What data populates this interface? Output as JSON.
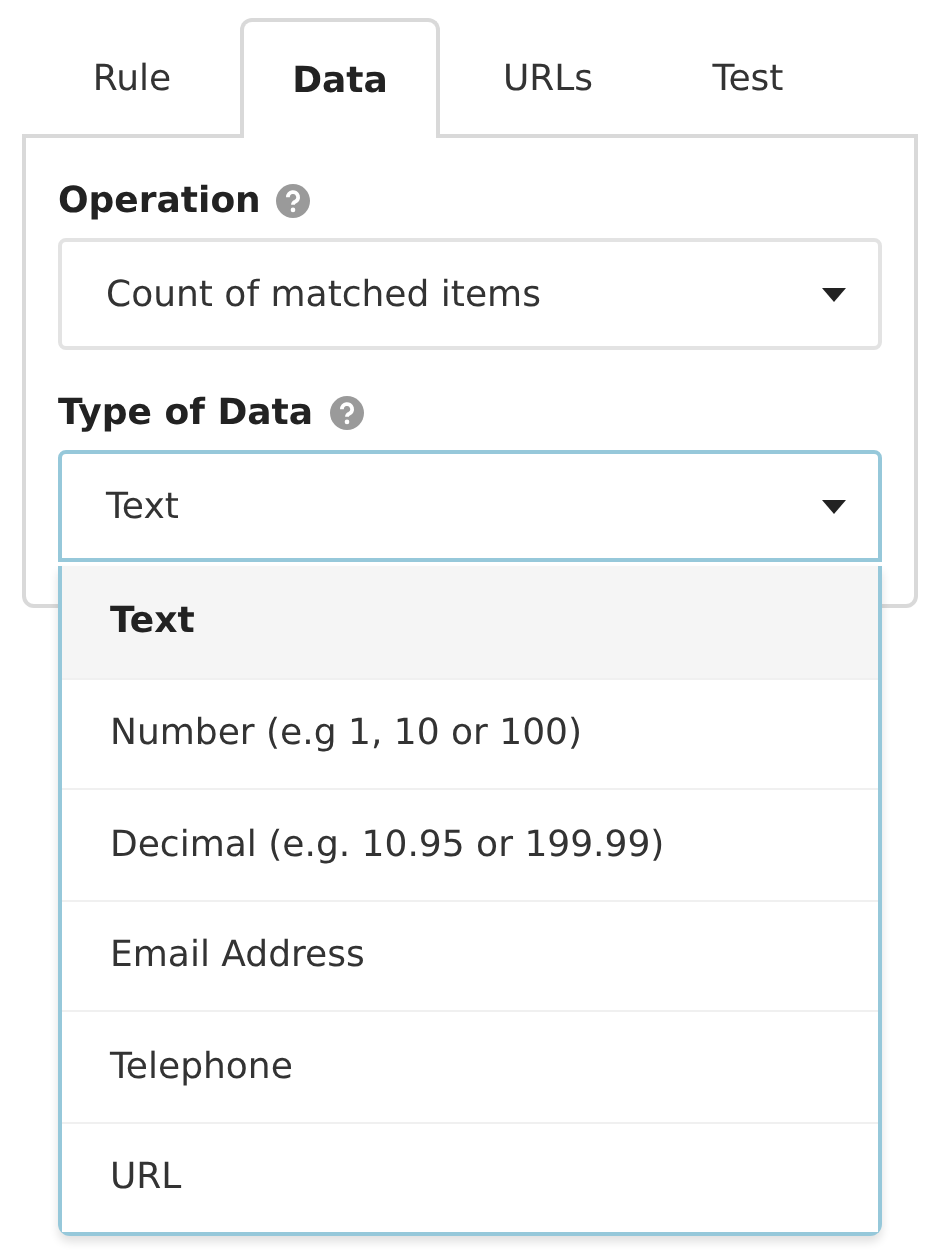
{
  "tabs": [
    {
      "label": "Rule",
      "selected": false
    },
    {
      "label": "Data",
      "selected": true
    },
    {
      "label": "URLs",
      "selected": false
    },
    {
      "label": "Test",
      "selected": false
    }
  ],
  "fields": [
    {
      "label": "Operation",
      "value": "Count of matched items",
      "expanded": false
    },
    {
      "label": "Type of Data",
      "value": "Text",
      "expanded": true,
      "options": [
        {
          "label": "Text",
          "selected": true
        },
        {
          "label": "Number (e.g 1, 10 or 100)",
          "selected": false
        },
        {
          "label": "Decimal (e.g. 10.95 or 199.99)",
          "selected": false
        },
        {
          "label": "Email Address",
          "selected": false
        },
        {
          "label": "Telephone",
          "selected": false
        },
        {
          "label": "URL",
          "selected": false
        }
      ]
    }
  ]
}
